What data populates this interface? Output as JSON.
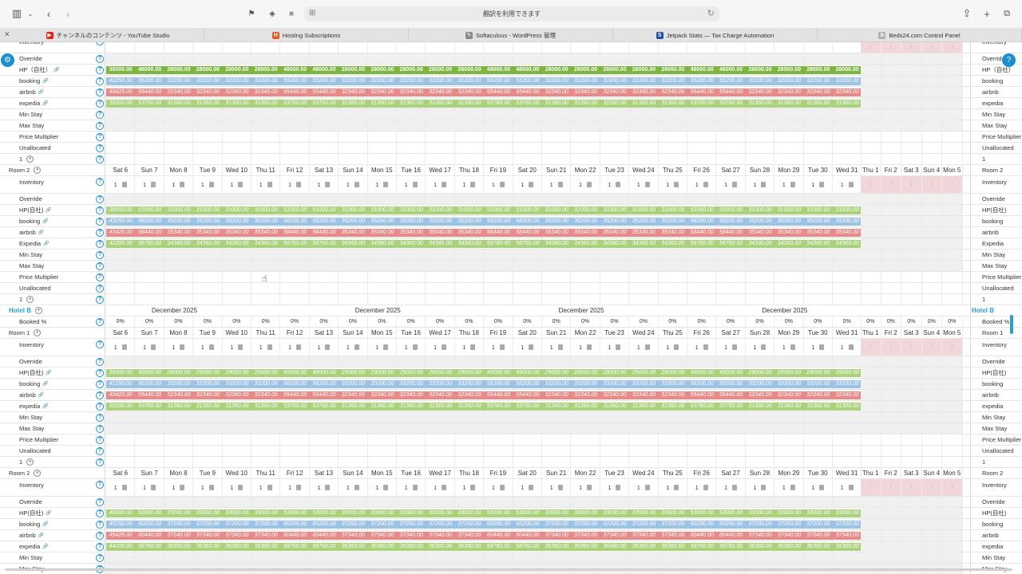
{
  "toolbar": {
    "address": "翻訳を利用できます",
    "sidebar_icon": "sidebar-icon",
    "back_icon": "chevron-left-icon",
    "forward_icon": "chevron-right-icon"
  },
  "tabs": [
    {
      "label": "チャンネルのコンテンツ - YouTube Studio",
      "color": "#e62117",
      "glyph": "▶"
    },
    {
      "label": "Hosting Subscriptions",
      "color": "#e8541e",
      "glyph": "H"
    },
    {
      "label": "Softaculous - WordPress 管理",
      "color": "#8a8a8a",
      "glyph": "✎"
    },
    {
      "label": "Jetpack Stats — Tax Charge Automation",
      "color": "#1e4fa0",
      "glyph": "S"
    },
    {
      "label": "Beds24.com Control Panel",
      "color": "#b0b0b0",
      "glyph": "b"
    }
  ],
  "dates": [
    "Sat 6",
    "Sun 7",
    "Mon 8",
    "Tue 9",
    "Wed 10",
    "Thu 11",
    "Fri 12",
    "Sat 13",
    "Sun 14",
    "Mon 15",
    "Tue 16",
    "Wed 17",
    "Thu 18",
    "Fri 19",
    "Sat 20",
    "Sun 21",
    "Mon 22",
    "Tue 23",
    "Wed 24",
    "Thu 25",
    "Fri 26",
    "Sat 27",
    "Sun 28",
    "Mon 29",
    "Tue 30",
    "Wed 31",
    "Thu 1",
    "Fri 2",
    "Sat 3",
    "Sun 4",
    "Mon 5"
  ],
  "month_label": "December 2025",
  "booked_pct": "0%",
  "labels": {
    "inventory": "Inventory",
    "override": "Override",
    "min_stay": "Min Stay",
    "max_stay": "Max Stay",
    "price_multiplier": "Price Multiplier",
    "unallocated": "Unallocated",
    "booked": "Booked %",
    "one": "1"
  },
  "colors": {
    "hp": "#7cb640",
    "booking": "#9cc3e6",
    "airbnb": "#e88a88",
    "expedia": "#a9d27a",
    "accent": "#1b8fcf"
  },
  "sections": [
    {
      "type": "rooms",
      "room": "",
      "rates": [
        {
          "label": "HP（自社）",
          "cls": "hp",
          "vals": [
            "35000.00",
            "48000.00",
            "28000.00",
            "28000.00",
            "28000.00",
            "28000.00",
            "48000.00",
            "48000.00",
            "28000.00",
            "28000.00",
            "28000.00",
            "28000.00",
            "28000.00",
            "48000.00",
            "48000.00",
            "28000.00",
            "28000.00",
            "28000.00",
            "28000.00",
            "28000.00",
            "48000.00",
            "48000.00",
            "28000.00",
            "28000.00",
            "28000.00",
            "28000.00"
          ]
        },
        {
          "label": "booking",
          "cls": "booking",
          "vals": [
            "40250.00",
            "55200.00",
            "32200.00",
            "32200.00",
            "32200.00",
            "32200.00",
            "55200.00",
            "55200.00",
            "32200.00",
            "32200.00",
            "32200.00",
            "32200.00",
            "32200.00",
            "55200.00",
            "55200.00",
            "32200.00",
            "32200.00",
            "32200.00",
            "32200.00",
            "32200.00",
            "55200.00",
            "55200.00",
            "32200.00",
            "32200.00",
            "32200.00",
            "32200.00"
          ]
        },
        {
          "label": "airbnb",
          "cls": "airbnb",
          "vals": [
            "40425.00",
            "55440.00",
            "32340.00",
            "32340.00",
            "32340.00",
            "32340.00",
            "55440.00",
            "55440.00",
            "32340.00",
            "32340.00",
            "32340.00",
            "32340.00",
            "32340.00",
            "55440.00",
            "55440.00",
            "32340.00",
            "32340.00",
            "32340.00",
            "32340.00",
            "32340.00",
            "55440.00",
            "55440.00",
            "32340.00",
            "32340.00",
            "32340.00",
            "32340.00"
          ]
        },
        {
          "label": "expedia",
          "cls": "expedia",
          "vals": [
            "39200.00",
            "53760.00",
            "31360.00",
            "31360.00",
            "31360.00",
            "31360.00",
            "53760.00",
            "53760.00",
            "31360.00",
            "31360.00",
            "31360.00",
            "31360.00",
            "31360.00",
            "53760.00",
            "53760.00",
            "31360.00",
            "31360.00",
            "31360.00",
            "31360.00",
            "31360.00",
            "53760.00",
            "53760.00",
            "31360.00",
            "31360.00",
            "31360.00",
            "31360.00"
          ]
        }
      ]
    },
    {
      "type": "rooms",
      "room": "Room 2",
      "rates": [
        {
          "label": "HP(自社)",
          "cls": "expedia",
          "vals": [
            "38000.00",
            "51000.00",
            "31000.00",
            "31000.00",
            "31000.00",
            "31000.00",
            "51000.00",
            "51000.00",
            "31000.00",
            "31000.00",
            "31000.00",
            "31000.00",
            "31000.00",
            "51000.00",
            "51000.00",
            "31000.00",
            "31000.00",
            "31000.00",
            "31000.00",
            "31000.00",
            "51000.00",
            "51000.00",
            "31000.00",
            "31000.00",
            "31000.00",
            "31000.00"
          ]
        },
        {
          "label": "booking",
          "cls": "booking",
          "vals": [
            "43250.00",
            "58200.00",
            "35200.00",
            "35200.00",
            "35200.00",
            "35200.00",
            "58200.00",
            "58200.00",
            "35200.00",
            "35200.00",
            "35200.00",
            "35200.00",
            "35200.00",
            "58200.00",
            "58200.00",
            "35200.00",
            "35200.00",
            "35200.00",
            "35200.00",
            "35200.00",
            "58200.00",
            "58200.00",
            "35200.00",
            "35200.00",
            "35200.00",
            "35200.00"
          ]
        },
        {
          "label": "airbnb",
          "cls": "airbnb",
          "vals": [
            "43425.00",
            "58440.00",
            "35340.00",
            "35340.00",
            "35340.00",
            "35340.00",
            "58440.00",
            "58440.00",
            "35340.00",
            "35340.00",
            "35340.00",
            "35340.00",
            "35340.00",
            "58440.00",
            "58440.00",
            "35340.00",
            "35340.00",
            "35340.00",
            "35340.00",
            "35340.00",
            "58440.00",
            "58440.00",
            "35340.00",
            "35340.00",
            "35340.00",
            "35340.00"
          ]
        },
        {
          "label": "Expedia",
          "cls": "expedia",
          "vals": [
            "42200.00",
            "56760.00",
            "34360.00",
            "34360.00",
            "34360.00",
            "34360.00",
            "56760.00",
            "56760.00",
            "34360.00",
            "34360.00",
            "34360.00",
            "34360.00",
            "34360.00",
            "56760.00",
            "56760.00",
            "34360.00",
            "34360.00",
            "34360.00",
            "34360.00",
            "34360.00",
            "56760.00",
            "56760.00",
            "34360.00",
            "34360.00",
            "34360.00",
            "34360.00"
          ]
        }
      ]
    },
    {
      "type": "rooms",
      "room": "Room 1",
      "rates": [
        {
          "label": "HP(自社)",
          "cls": "expedia",
          "vals": [
            "36000.00",
            "49000.00",
            "29000.00",
            "29000.00",
            "29000.00",
            "29000.00",
            "49000.00",
            "49000.00",
            "29000.00",
            "29000.00",
            "29000.00",
            "29000.00",
            "29000.00",
            "49000.00",
            "49000.00",
            "29000.00",
            "29000.00",
            "29000.00",
            "29000.00",
            "29000.00",
            "49000.00",
            "49000.00",
            "29000.00",
            "29000.00",
            "29000.00",
            "29000.00"
          ]
        },
        {
          "label": "booking",
          "cls": "booking",
          "vals": [
            "41250.00",
            "56200.00",
            "33200.00",
            "33200.00",
            "33200.00",
            "33200.00",
            "56200.00",
            "56200.00",
            "33200.00",
            "33200.00",
            "33200.00",
            "33200.00",
            "33200.00",
            "56200.00",
            "56200.00",
            "33200.00",
            "33200.00",
            "33200.00",
            "33200.00",
            "33200.00",
            "56200.00",
            "56200.00",
            "33200.00",
            "33200.00",
            "33200.00",
            "33200.00"
          ]
        },
        {
          "label": "airbnb",
          "cls": "airbnb",
          "vals": [
            "40425.00",
            "55440.00",
            "32340.00",
            "32340.00",
            "32340.00",
            "32340.00",
            "55440.00",
            "55440.00",
            "32340.00",
            "32340.00",
            "32340.00",
            "32340.00",
            "32340.00",
            "55440.00",
            "55440.00",
            "32340.00",
            "32340.00",
            "32340.00",
            "32340.00",
            "32340.00",
            "55440.00",
            "55440.00",
            "32340.00",
            "32340.00",
            "32340.00",
            "32340.00"
          ]
        },
        {
          "label": "expedia",
          "cls": "expedia",
          "vals": [
            "39200.00",
            "53760.00",
            "31360.00",
            "31360.00",
            "31360.00",
            "31360.00",
            "53760.00",
            "53760.00",
            "31360.00",
            "31360.00",
            "31360.00",
            "31360.00",
            "31360.00",
            "53760.00",
            "53760.00",
            "31360.00",
            "31360.00",
            "31360.00",
            "31360.00",
            "31360.00",
            "53760.00",
            "53760.00",
            "31360.00",
            "31360.00",
            "31360.00",
            "31360.00"
          ]
        }
      ]
    },
    {
      "type": "rooms",
      "room": "Room 2",
      "rates": [
        {
          "label": "HP(自社)",
          "cls": "expedia",
          "vals": [
            "40000.00",
            "53000.00",
            "33000.00",
            "33000.00",
            "33000.00",
            "33000.00",
            "53000.00",
            "53000.00",
            "33000.00",
            "33000.00",
            "33000.00",
            "33000.00",
            "33000.00",
            "53000.00",
            "53000.00",
            "33000.00",
            "33000.00",
            "33000.00",
            "33000.00",
            "33000.00",
            "53000.00",
            "53000.00",
            "33000.00",
            "33000.00",
            "33000.00",
            "33000.00"
          ]
        },
        {
          "label": "booking",
          "cls": "booking",
          "vals": [
            "45250.00",
            "60200.00",
            "37200.00",
            "37200.00",
            "37200.00",
            "37200.00",
            "60200.00",
            "60200.00",
            "37200.00",
            "37200.00",
            "37200.00",
            "37200.00",
            "37200.00",
            "60200.00",
            "60200.00",
            "37200.00",
            "37200.00",
            "37200.00",
            "37200.00",
            "37200.00",
            "60200.00",
            "60200.00",
            "37200.00",
            "37200.00",
            "37200.00",
            "37200.00"
          ]
        },
        {
          "label": "airbnb",
          "cls": "airbnb",
          "vals": [
            "45425.00",
            "60440.00",
            "37340.00",
            "37340.00",
            "37340.00",
            "37340.00",
            "60440.00",
            "60440.00",
            "37340.00",
            "37340.00",
            "37340.00",
            "37340.00",
            "37340.00",
            "60440.00",
            "60440.00",
            "37340.00",
            "37340.00",
            "37340.00",
            "37340.00",
            "37340.00",
            "60440.00",
            "60440.00",
            "37340.00",
            "37340.00",
            "37340.00",
            "37340.00"
          ]
        },
        {
          "label": "expedia",
          "cls": "expedia",
          "vals": [
            "44200.00",
            "58760.00",
            "36360.00",
            "36360.00",
            "36360.00",
            "36360.00",
            "58760.00",
            "58760.00",
            "36360.00",
            "36360.00",
            "36360.00",
            "36360.00",
            "36360.00",
            "58760.00",
            "58760.00",
            "36360.00",
            "36360.00",
            "36360.00",
            "36360.00",
            "36360.00",
            "58760.00",
            "58760.00",
            "36360.00",
            "36360.00",
            "36360.00",
            "36360.00"
          ]
        }
      ]
    }
  ],
  "hotel_b": "Hotel B",
  "rlabels": {
    "hp": "HP(自社)",
    "booking": "booking",
    "airbnb": "airbnb",
    "expedia": "expedia",
    "Expedia": "Expedia"
  }
}
